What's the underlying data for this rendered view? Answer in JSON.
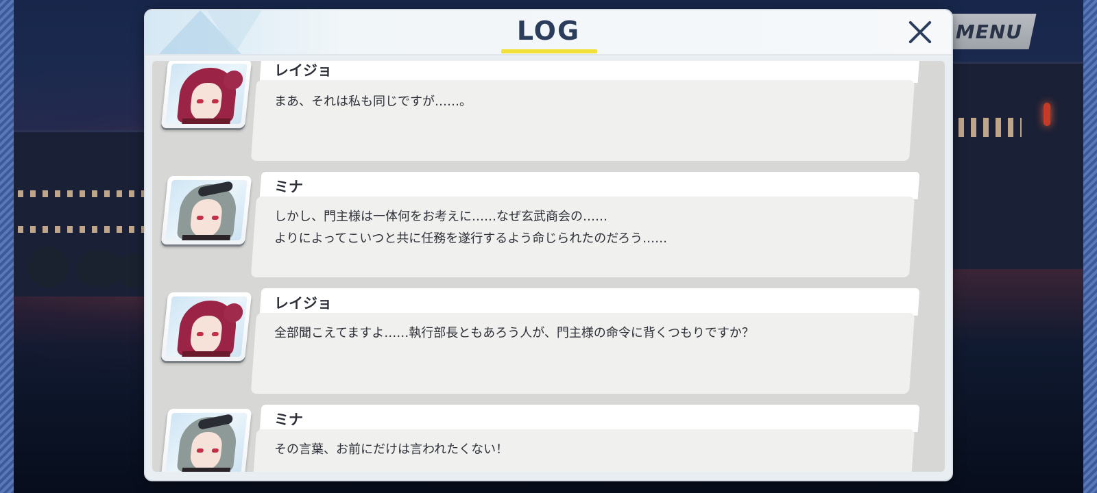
{
  "header": {
    "title": "LOG",
    "close_icon": "close-icon",
    "menu_label": "MENU"
  },
  "entries": [
    {
      "speaker": "レイジョ",
      "portrait": "reijo",
      "lines": [
        "まあ、それは私も同じですが……。"
      ]
    },
    {
      "speaker": "ミナ",
      "portrait": "mina",
      "lines": [
        "しかし、門主様は一体何をお考えに……なぜ玄武商会の……",
        "よりによってこいつと共に任務を遂行するよう命じられたのだろう……"
      ]
    },
    {
      "speaker": "レイジョ",
      "portrait": "reijo",
      "lines": [
        "全部聞こえてますよ……執行部長ともあろう人が、門主様の命令に背くつもりですか？"
      ]
    },
    {
      "speaker": "ミナ",
      "portrait": "mina",
      "lines": [
        "その言葉、お前にだけは言われたくない！"
      ]
    }
  ],
  "colors": {
    "title": "#2b3d5c",
    "underline": "#f2e03a",
    "bubble": "#f0f0ee",
    "panel": "#e9eef2",
    "menu": "#a9aeb5"
  }
}
